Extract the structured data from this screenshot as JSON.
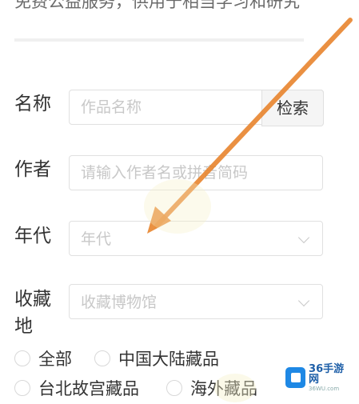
{
  "header": {
    "partial_text": "免费公益服务，供用于相当学习和研究"
  },
  "form": {
    "name": {
      "label": "名称",
      "placeholder": "作品名称",
      "search_label": "检索"
    },
    "author": {
      "label": "作者",
      "placeholder": "请输入作者名或拼音简码"
    },
    "era": {
      "label": "年代",
      "placeholder": "年代",
      "icon": "chevron-down-icon"
    },
    "collection": {
      "label": "收藏地",
      "placeholder": "收藏博物馆",
      "icon": "chevron-down-icon"
    }
  },
  "source_options": [
    {
      "label": "全部"
    },
    {
      "label": "中国大陆藏品"
    },
    {
      "label": "台北故宫藏品"
    },
    {
      "label": "海外藏品"
    }
  ],
  "watermark": {
    "brand": "36手游网",
    "sub": "36WU.com",
    "arrow_color": "#e8852e"
  }
}
